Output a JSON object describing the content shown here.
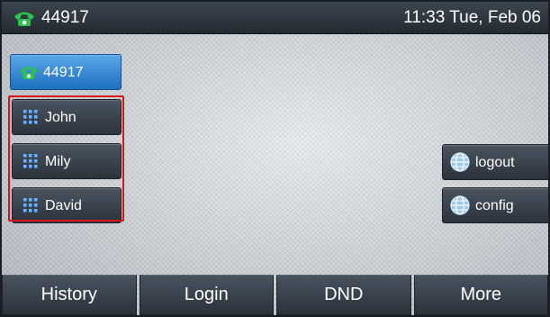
{
  "status_bar": {
    "account": "44917",
    "clock": "11:33 Tue, Feb 06"
  },
  "line_keys": {
    "account": {
      "label": "44917",
      "icon": "green-phone-icon"
    },
    "contacts": [
      {
        "label": "John",
        "icon": "dialpad-icon"
      },
      {
        "label": "Mily",
        "icon": "dialpad-icon"
      },
      {
        "label": "David",
        "icon": "dialpad-icon"
      }
    ],
    "right": [
      {
        "label": "logout",
        "icon": "globe-icon"
      },
      {
        "label": "config",
        "icon": "globe-icon"
      }
    ]
  },
  "softkeys": [
    "History",
    "Login",
    "DND",
    "More"
  ],
  "colors": {
    "highlight": "#d9121b",
    "active_key": "#2f86d6",
    "phone_icon": "#22c03a"
  }
}
